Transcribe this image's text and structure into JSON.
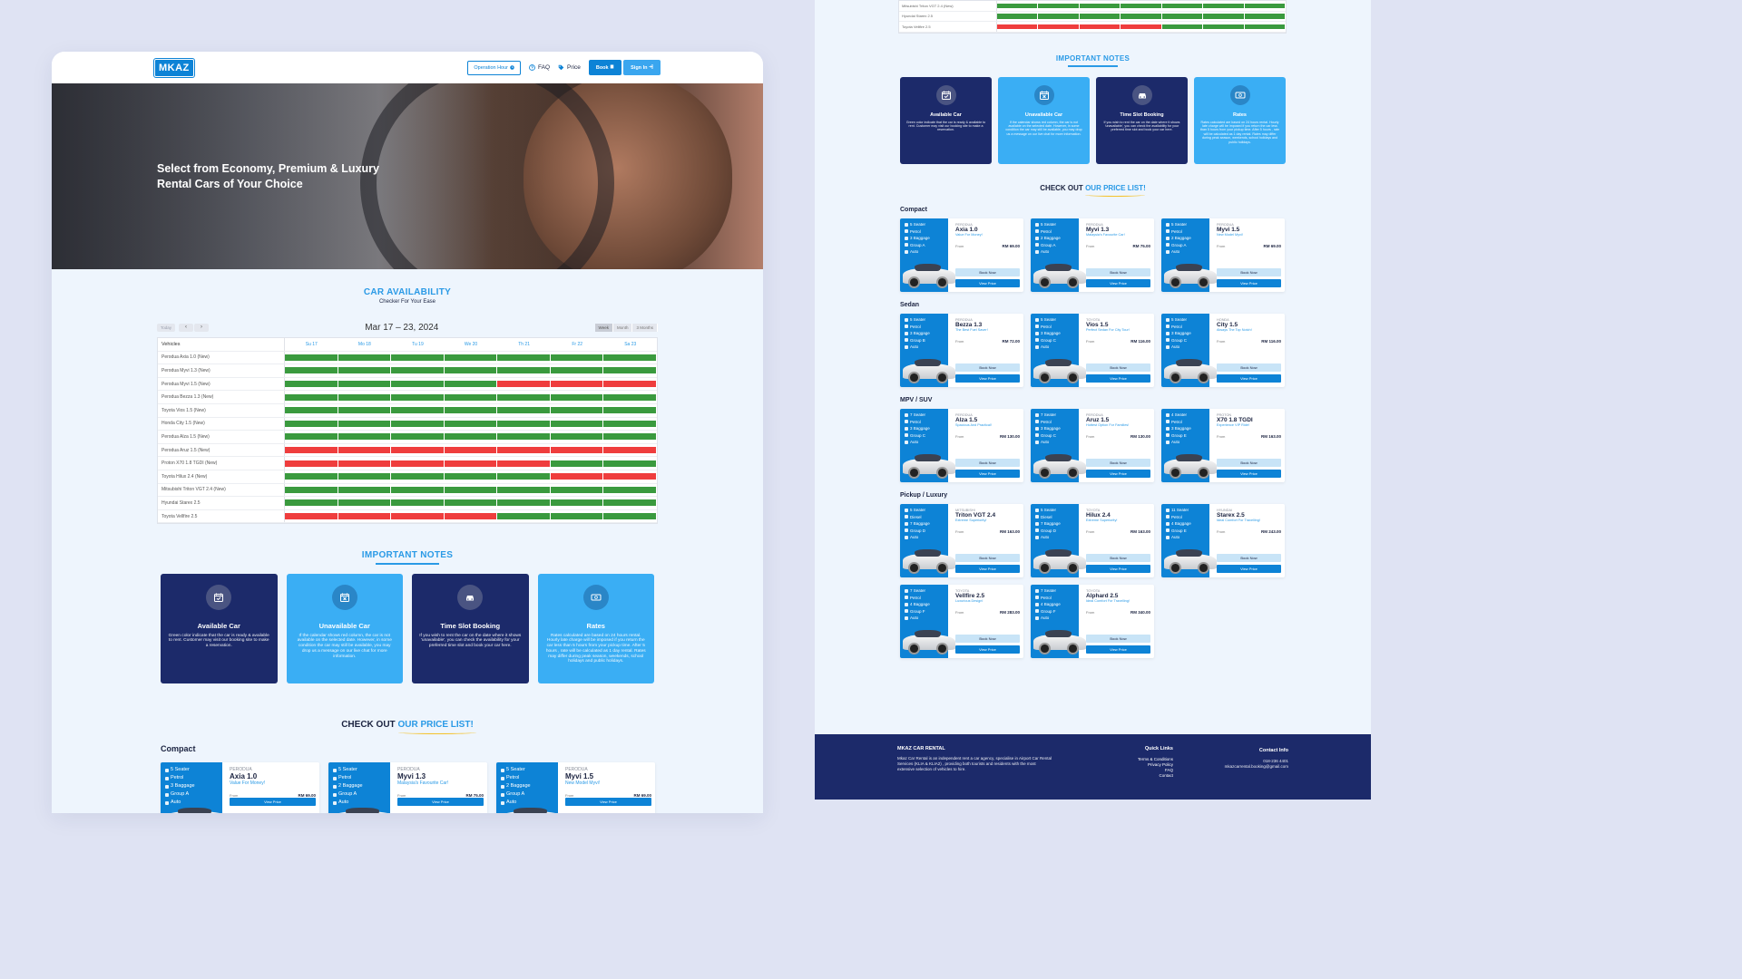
{
  "left": {
    "nav": {
      "logo": "MKAZ",
      "operation_hour": "Operation Hour",
      "faq": "FAQ",
      "price": "Price",
      "book": "Book",
      "sign_in": "Sign In"
    },
    "hero": {
      "headline_1": "Select from Economy, Premium & Luxury",
      "headline_2": "Rental Cars of Your Choice"
    },
    "availability": {
      "title": "CAR AVAILABILITY",
      "subtitle": "Checker For Your Ease",
      "today": "Today",
      "range": "Mar 17 – 23, 2024",
      "views": [
        "Week",
        "Month",
        "3 Months"
      ],
      "vehicles_header": "Vehicles",
      "days": [
        "Su 17",
        "Mo 18",
        "Tu 19",
        "We 20",
        "Th 21",
        "Fr 22",
        "Sa 23"
      ],
      "rows": [
        {
          "name": "Perodua Axia 1.0 (New)",
          "status": "ggggggg"
        },
        {
          "name": "Perodua Myvi 1.3 (New)",
          "status": "ggggggg"
        },
        {
          "name": "Perodua Myvi 1.5 (New)",
          "status": "ggggrrr"
        },
        {
          "name": "Perodua Bezza 1.3 (New)",
          "status": "ggggggg"
        },
        {
          "name": "Toyota Vios 1.5 (New)",
          "status": "ggggggg"
        },
        {
          "name": "Honda City 1.5 (New)",
          "status": "ggggggg"
        },
        {
          "name": "Perodua Alza 1.5 (New)",
          "status": "ggggggg"
        },
        {
          "name": "Perodua Aruz 1.5 (New)",
          "status": "rrrrrrr"
        },
        {
          "name": "Proton X70 1.8 TGDI (New)",
          "status": "rrrrrgg"
        },
        {
          "name": "Toyota Hilux 2.4 (New)",
          "status": "gggggrr"
        },
        {
          "name": "Mitsubishi Triton VGT 2.4 (New)",
          "status": "ggggggg"
        },
        {
          "name": "Hyundai Starex 2.5",
          "status": "ggggggg"
        },
        {
          "name": "Toyota Vellfire 2.5",
          "status": "rrrrggg"
        }
      ]
    },
    "notes_title": "IMPORTANT NOTES",
    "checkout_prefix": "CHECK OUT",
    "checkout_highlight": "OUR PRICE LIST!",
    "compact_label": "Compact"
  },
  "notes": [
    {
      "title": "Available Car",
      "text": "Green color indicate that the car is ready & available to rent. Customer may visit our booking site to make a reservation.",
      "style": "dark",
      "icon": "calendar-check-icon"
    },
    {
      "title": "Unavailable Car",
      "text": "If the calendar shows red column, the car is not available on the selected date. However, in some condition the car may still be available, you may drop us a message on our live chat for more information.",
      "style": "light",
      "icon": "calendar-x-icon"
    },
    {
      "title": "Time Slot Booking",
      "text": "If you wish to rent the car on the date where it shows 'unavailable', you can check the availability for your preferred time slot and book your car here.",
      "style": "dark",
      "icon": "car-icon"
    },
    {
      "title": "Rates",
      "text": "Rates calculated are based on 24 hours rental. Hourly late charge will be imposed if you return the car less than 5 hours from your pickup time. After 5 hours , rate will be calculated as 1 day rental. Rates may differ during peak season, weekends, school holidays and public holidays.",
      "style": "light",
      "icon": "money-icon"
    }
  ],
  "right": {
    "partial_rows": [
      {
        "name": "Mitsubishi Triton VGT 2.4 (New)",
        "status": "ggggggg"
      },
      {
        "name": "Hyundai Starex 2.5",
        "status": "ggggggg"
      },
      {
        "name": "Toyota Vellfire 2.5",
        "status": "rrrrggg"
      }
    ],
    "notes_title": "IMPORTANT NOTES",
    "checkout_prefix": "CHECK OUT",
    "checkout_highlight": "OUR PRICE LIST!"
  },
  "from_label": "From",
  "book_now": "Book Now",
  "view_price": "View Price",
  "categories": [
    {
      "name": "Compact",
      "cars": [
        {
          "brand": "PERODUA",
          "model": "Axia 1.0",
          "tag": "Value For Money!",
          "price": "RM 69.00",
          "seats": "5 Seater",
          "fuel": "Petrol",
          "bags": "3 Baggage",
          "group": "Group A",
          "trans": "Auto"
        },
        {
          "brand": "PERODUA",
          "model": "Myvi 1.3",
          "tag": "Malaysia's Favourite Car!",
          "price": "RM 75.00",
          "seats": "5 Seater",
          "fuel": "Petrol",
          "bags": "2 Baggage",
          "group": "Group A",
          "trans": "Auto"
        },
        {
          "brand": "PERODUA",
          "model": "Myvi 1.5",
          "tag": "New Model Myvi!",
          "price": "RM 69.00",
          "seats": "5 Seater",
          "fuel": "Petrol",
          "bags": "2 Baggage",
          "group": "Group A",
          "trans": "Auto"
        }
      ]
    },
    {
      "name": "Sedan",
      "cars": [
        {
          "brand": "PERODUA",
          "model": "Bezza 1.3",
          "tag": "The Best Fuel Saver!",
          "price": "RM 72.00",
          "seats": "5 Seater",
          "fuel": "Petrol",
          "bags": "3 Baggage",
          "group": "Group B",
          "trans": "Auto"
        },
        {
          "brand": "TOYOTA",
          "model": "Vios 1.5",
          "tag": "Perfect Sedan For City Tour!",
          "price": "RM 116.00",
          "seats": "5 Seater",
          "fuel": "Petrol",
          "bags": "3 Baggage",
          "group": "Group C",
          "trans": "Auto"
        },
        {
          "brand": "HONDA",
          "model": "City 1.5",
          "tag": "Always The Top Notch!",
          "price": "RM 116.00",
          "seats": "5 Seater",
          "fuel": "Petrol",
          "bags": "3 Baggage",
          "group": "Group C",
          "trans": "Auto"
        }
      ]
    },
    {
      "name": "MPV / SUV",
      "cars": [
        {
          "brand": "PERODUA",
          "model": "Alza 1.5",
          "tag": "Spacious And Practical!",
          "price": "RM 130.00",
          "seats": "7 Seater",
          "fuel": "Petrol",
          "bags": "3 Baggage",
          "group": "Group C",
          "trans": "Auto"
        },
        {
          "brand": "PERODUA",
          "model": "Aruz 1.5",
          "tag": "Hottest Option For Families!",
          "price": "RM 130.00",
          "seats": "7 Seater",
          "fuel": "Petrol",
          "bags": "3 Baggage",
          "group": "Group C",
          "trans": "Auto"
        },
        {
          "brand": "PROTON",
          "model": "X70 1.8 TGDI",
          "tag": "Experience VIP Ride!",
          "price": "RM 163.00",
          "seats": "4 Seater",
          "fuel": "Petrol",
          "bags": "3 Baggage",
          "group": "Group E",
          "trans": "Auto"
        }
      ]
    },
    {
      "name": "Pickup / Luxury",
      "cars": [
        {
          "brand": "MITSUBISHI",
          "model": "Triton VGT 2.4",
          "tag": "Extreme Superiority!",
          "price": "RM 163.00",
          "seats": "5 Seater",
          "fuel": "Diesel",
          "bags": "7 Baggage",
          "group": "Group D",
          "trans": "Auto"
        },
        {
          "brand": "TOYOTA",
          "model": "Hilux 2.4",
          "tag": "Extreme Superiority!",
          "price": "RM 163.00",
          "seats": "5 Seater",
          "fuel": "Diesel",
          "bags": "7 Baggage",
          "group": "Group D",
          "trans": "Auto"
        },
        {
          "brand": "HYUNDAI",
          "model": "Starex 2.5",
          "tag": "Ideal Comfort For Travelling!",
          "price": "RM 243.00",
          "seats": "11 Seater",
          "fuel": "Petrol",
          "bags": "4 Baggage",
          "group": "Group E",
          "trans": "Auto"
        },
        {
          "brand": "TOYOTA",
          "model": "Vellfire 2.5",
          "tag": "Luxurious Design!",
          "price": "RM 283.00",
          "seats": "7 Seater",
          "fuel": "Petrol",
          "bags": "4 Baggage",
          "group": "Group F",
          "trans": "Auto"
        },
        {
          "brand": "TOYOTA",
          "model": "Alphard 2.5",
          "tag": "Ideal Comfort For Travelling!",
          "price": "RM 340.00",
          "seats": "7 Seater",
          "fuel": "Petrol",
          "bags": "4 Baggage",
          "group": "Group F",
          "trans": "Auto"
        }
      ]
    }
  ],
  "footer": {
    "brand": "MKAZ CAR RENTAL",
    "about": "Mkaz Car Rental is an independent rent a car agency, specialise in Airport Car Rental Services (KLIA & KLIA2) , providing both tourists and residents with the most extensive selection of vehicles to hire.",
    "quick_links_title": "Quick Links",
    "links": [
      "Terms & Conditions",
      "Privacy Policy",
      "FAQ",
      "Contact"
    ],
    "contact_title": "Contact Info",
    "phone": "018-236 4401",
    "email": "mkazcarrental.booking@gmail.com"
  },
  "colors": {
    "primary": "#0d83d6",
    "dark": "#1c2a6a",
    "available": "#3a9a3e",
    "unavailable": "#ef3d3d",
    "accent": "#2a9ae6"
  }
}
